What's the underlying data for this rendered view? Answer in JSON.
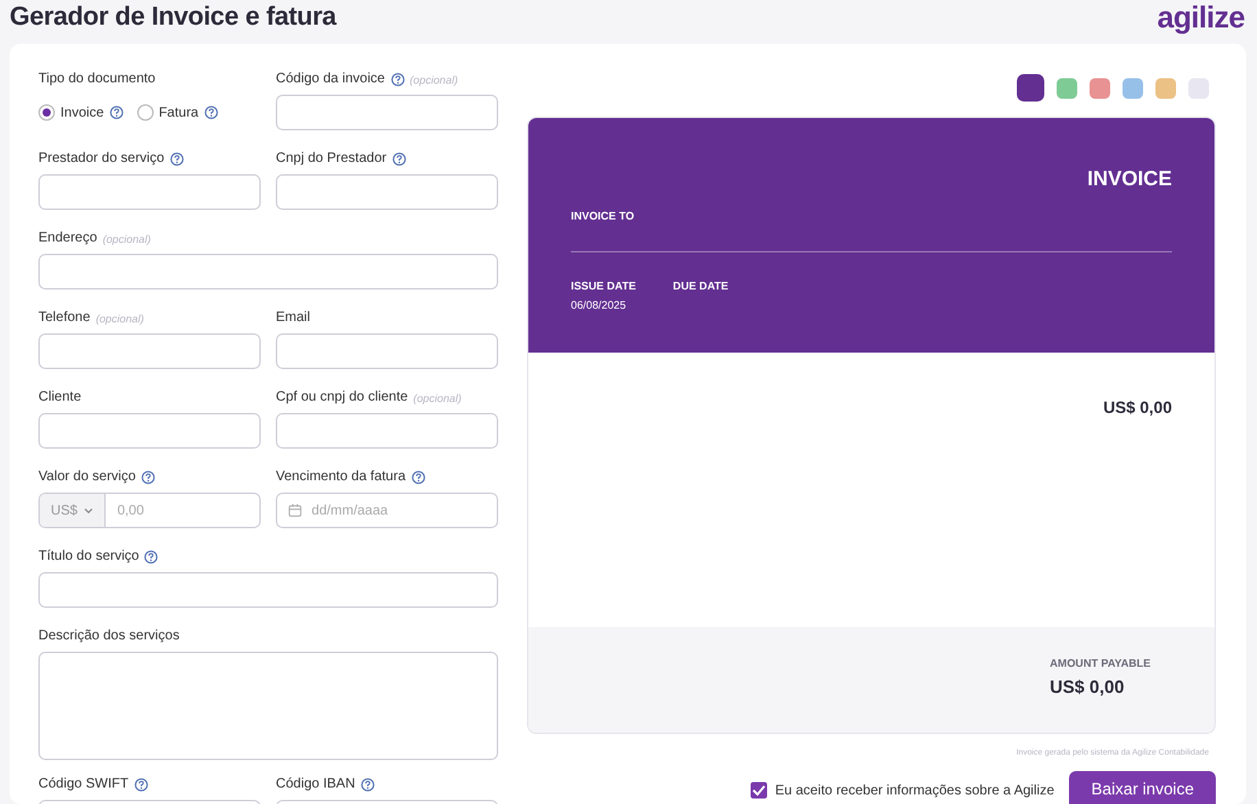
{
  "page": {
    "title": "Gerador de Invoice e fatura",
    "logo": "agilize"
  },
  "form": {
    "rows": [
      [
        {
          "kind": "radio-group",
          "label": "Tipo do documento",
          "help": false,
          "options": [
            {
              "label": "Invoice",
              "help": true,
              "selected": true
            },
            {
              "label": "Fatura",
              "help": true,
              "selected": false
            }
          ]
        },
        {
          "kind": "text",
          "label": "Código da invoice",
          "help": true,
          "optional": "(opcional)"
        }
      ],
      [
        {
          "kind": "text",
          "label": "Prestador do serviço",
          "help": true
        },
        {
          "kind": "text",
          "label": "Cnpj do Prestador",
          "help": true
        }
      ],
      [
        {
          "kind": "text",
          "label": "Endereço",
          "help": false,
          "optional": "(opcional)"
        }
      ],
      [
        {
          "kind": "text",
          "label": "Telefone",
          "help": false,
          "optional": "(opcional)"
        },
        {
          "kind": "text",
          "label": "Email",
          "help": false
        }
      ],
      [
        {
          "kind": "text",
          "label": "Cliente",
          "help": false
        },
        {
          "kind": "text",
          "label": "Cpf ou cnpj do cliente",
          "help": false,
          "optional": "(opcional)"
        }
      ],
      [
        {
          "kind": "money",
          "label": "Valor do serviço",
          "help": true,
          "currency": "US$",
          "placeholder": "0,00"
        },
        {
          "kind": "date",
          "label": "Vencimento da fatura",
          "help": true,
          "placeholder": "dd/mm/aaaa"
        }
      ],
      [
        {
          "kind": "text",
          "label": "Título do serviço",
          "help": true
        }
      ],
      [
        {
          "kind": "textarea",
          "label": "Descrição dos serviços",
          "help": false
        }
      ],
      [
        {
          "kind": "text",
          "label": "Código SWIFT",
          "help": true
        },
        {
          "kind": "text",
          "label": "Código IBAN",
          "help": true
        }
      ]
    ]
  },
  "swatches": [
    {
      "color": "#632f91",
      "selected": true
    },
    {
      "color": "#7fcb96",
      "selected": false
    },
    {
      "color": "#e89293",
      "selected": false
    },
    {
      "color": "#97c0e9",
      "selected": false
    },
    {
      "color": "#ecc185",
      "selected": false
    },
    {
      "color": "#e8e6f0",
      "selected": false
    }
  ],
  "preview": {
    "heading": "INVOICE",
    "invoice_to": "INVOICE TO",
    "issue_date_label": "ISSUE DATE",
    "issue_date": "06/08/2025",
    "due_date_label": "DUE DATE",
    "total": "US$ 0,00",
    "amount_label": "AMOUNT PAYABLE",
    "amount": "US$ 0,00"
  },
  "note": "Invoice gerada pelo sistema da Agilize Contabilidade",
  "consent": {
    "label": "Eu aceito receber informações sobre a Agilize",
    "checked": true
  },
  "download_button": "Baixar invoice"
}
